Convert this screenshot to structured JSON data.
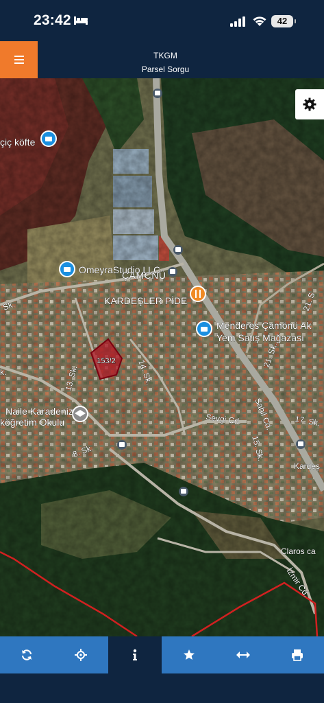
{
  "status": {
    "time": "23:42",
    "battery": "42"
  },
  "header": {
    "title": "TKGM",
    "subtitle": "Parsel Sorgu"
  },
  "map": {
    "parcel_label": "153/2",
    "pois": [
      "çiç köfte",
      "OmeyraStudio LLC",
      "ÇAMCNÜ",
      "KARDEŞLER PİDE",
      "Menderes Çamönü Ak",
      "Yem Satış Mağazası",
      "Naile Karadeniz",
      "köğretim Okulu"
    ],
    "streets": [
      "13. Sk.",
      "14. Sk.",
      "8. Sk.",
      "Sevgi Cd.",
      "Sahil Cd.",
      "21. Sk.",
      "15. Sk.",
      "17. Sk.",
      "Kardeş",
      "Claros ca",
      "İzmir Cd.",
      "k.",
      "21. S",
      "Sk."
    ]
  },
  "toolbar": {
    "items": [
      "refresh-icon",
      "locate-icon",
      "info-icon",
      "star-icon",
      "measure-icon",
      "print-icon"
    ]
  },
  "colors": {
    "bar": "#0f2540",
    "toolbar": "#2f77c0",
    "menu": "#f07a2b",
    "parcel": "#b01825"
  }
}
